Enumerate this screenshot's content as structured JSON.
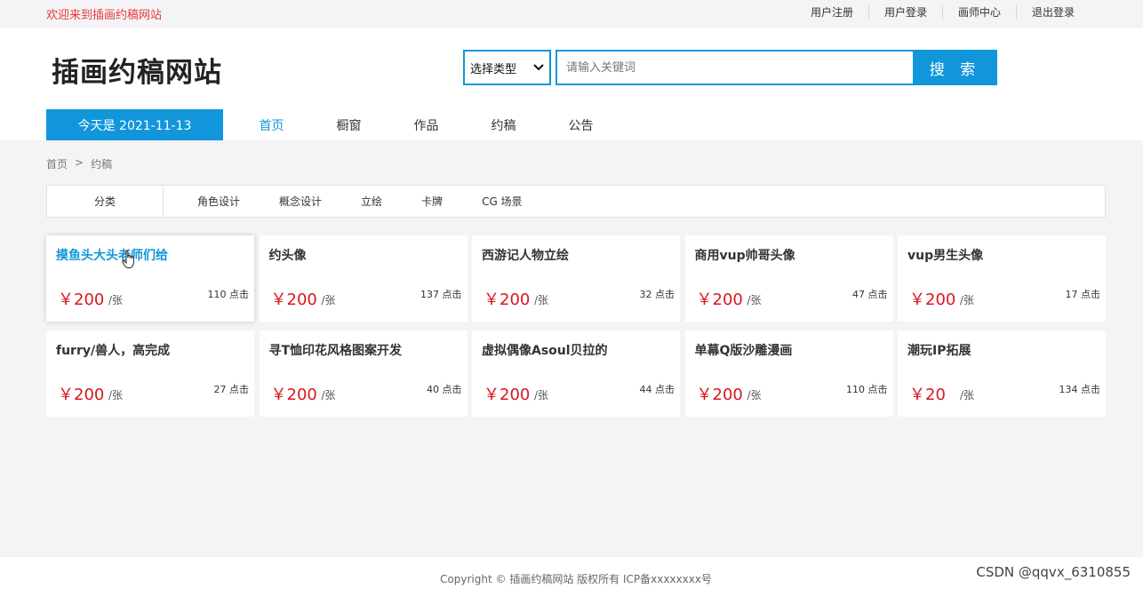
{
  "topbar": {
    "welcome": "欢迎来到插画约稿网站",
    "links": [
      "用户注册",
      "用户登录",
      "画师中心",
      "退出登录"
    ]
  },
  "header": {
    "logo": "插画约稿网站",
    "select_label": "选择类型",
    "search_placeholder": "请输入关键词",
    "search_button": "搜 索"
  },
  "nav": {
    "date_text": "今天是 2021-11-13",
    "items": [
      "首页",
      "橱窗",
      "作品",
      "约稿",
      "公告"
    ],
    "active_index": 0
  },
  "breadcrumb": {
    "home": "首页",
    "separator": ">",
    "current": "约稿"
  },
  "categories": {
    "title": "分类",
    "items": [
      "角色设计",
      "概念设计",
      "立绘",
      "卡牌",
      "CG 场景"
    ]
  },
  "cards": [
    {
      "title": "摸鱼头大头老师们给",
      "price": "￥200",
      "unit": "/张",
      "clicks": "110 点击"
    },
    {
      "title": "约头像",
      "price": "￥200",
      "unit": "/张",
      "clicks": "137 点击"
    },
    {
      "title": "西游记人物立绘",
      "price": "￥200",
      "unit": "/张",
      "clicks": "32 点击"
    },
    {
      "title": "商用vup帅哥头像",
      "price": "￥200",
      "unit": "/张",
      "clicks": "47 点击"
    },
    {
      "title": "vup男生头像",
      "price": "￥200",
      "unit": "/张",
      "clicks": "17 点击"
    },
    {
      "title": "furry/兽人，高完成",
      "price": "￥200",
      "unit": "/张",
      "clicks": "27 点击"
    },
    {
      "title": "寻T恤印花风格图案开发",
      "price": "￥200",
      "unit": "/张",
      "clicks": "40 点击"
    },
    {
      "title": "虚拟偶像Asoul贝拉的",
      "price": "￥200",
      "unit": "/张",
      "clicks": "44 点击"
    },
    {
      "title": "单幕Q版沙雕漫画",
      "price": "￥200",
      "unit": "/张",
      "clicks": "110 点击"
    },
    {
      "title": "潮玩IP拓展",
      "price": "￥20",
      "unit": "/张",
      "clicks": "134 点击"
    }
  ],
  "footer": {
    "copyright": "Copyright © 插画约稿网站 版权所有 ICP备xxxxxxxx号",
    "watermark": "CSDN @qqvx_6310855"
  },
  "colors": {
    "accent": "#1296db",
    "price": "#d9161d",
    "welcome": "#e4393c",
    "background": "#f4f4f6"
  }
}
